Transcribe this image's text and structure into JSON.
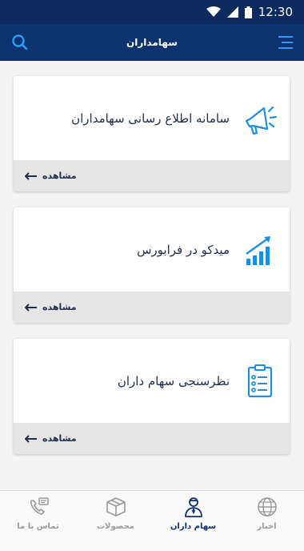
{
  "status": {
    "time": "12:30"
  },
  "app_bar": {
    "title": "سهامداران"
  },
  "cards": [
    {
      "title": "سامانه اطلاع رسانی سهامداران",
      "action": "مشاهده",
      "icon": "megaphone-icon"
    },
    {
      "title": "میدکو در فرابورس",
      "action": "مشاهده",
      "icon": "growth-chart-icon"
    },
    {
      "title": "نظرسنجی سهام داران",
      "action": "مشاهده",
      "icon": "clipboard-checklist-icon"
    }
  ],
  "bottom_nav": {
    "items": [
      {
        "label": "تماس با ما",
        "icon": "contact-icon",
        "active": false
      },
      {
        "label": "محصولات",
        "icon": "box-icon",
        "active": false
      },
      {
        "label": "سهام داران",
        "icon": "shareholder-icon",
        "active": true
      },
      {
        "label": "اخبار",
        "icon": "globe-icon",
        "active": false
      }
    ]
  },
  "colors": {
    "primary": "#0d3270",
    "accent": "#1e8ee0",
    "background": "#f4f4f4"
  }
}
